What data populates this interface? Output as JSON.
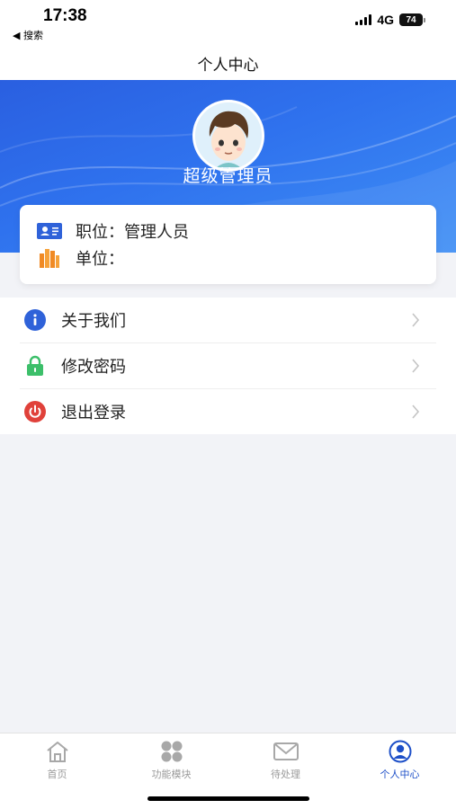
{
  "status": {
    "time": "17:38",
    "back_label": "◀ 搜索",
    "network": "4G",
    "battery": "74"
  },
  "nav": {
    "title": "个人中心"
  },
  "profile": {
    "name": "超级管理员",
    "position_label": "职位：",
    "position_value": "管理人员",
    "unit_label": "单位：",
    "unit_value": ""
  },
  "menu": [
    {
      "label": "关于我们",
      "icon": "info-icon"
    },
    {
      "label": "修改密码",
      "icon": "lock-icon"
    },
    {
      "label": "退出登录",
      "icon": "power-icon"
    }
  ],
  "tabs": [
    {
      "label": "首页",
      "icon": "home-icon"
    },
    {
      "label": "功能模块",
      "icon": "grid-icon"
    },
    {
      "label": "待处理",
      "icon": "mail-icon"
    },
    {
      "label": "个人中心",
      "icon": "user-icon",
      "active": true
    }
  ],
  "colors": {
    "primary": "#2f6fec",
    "active_tab": "#1d4fc8",
    "info": "#2f62d9",
    "lock": "#3cbf6a",
    "power": "#e0413a"
  }
}
